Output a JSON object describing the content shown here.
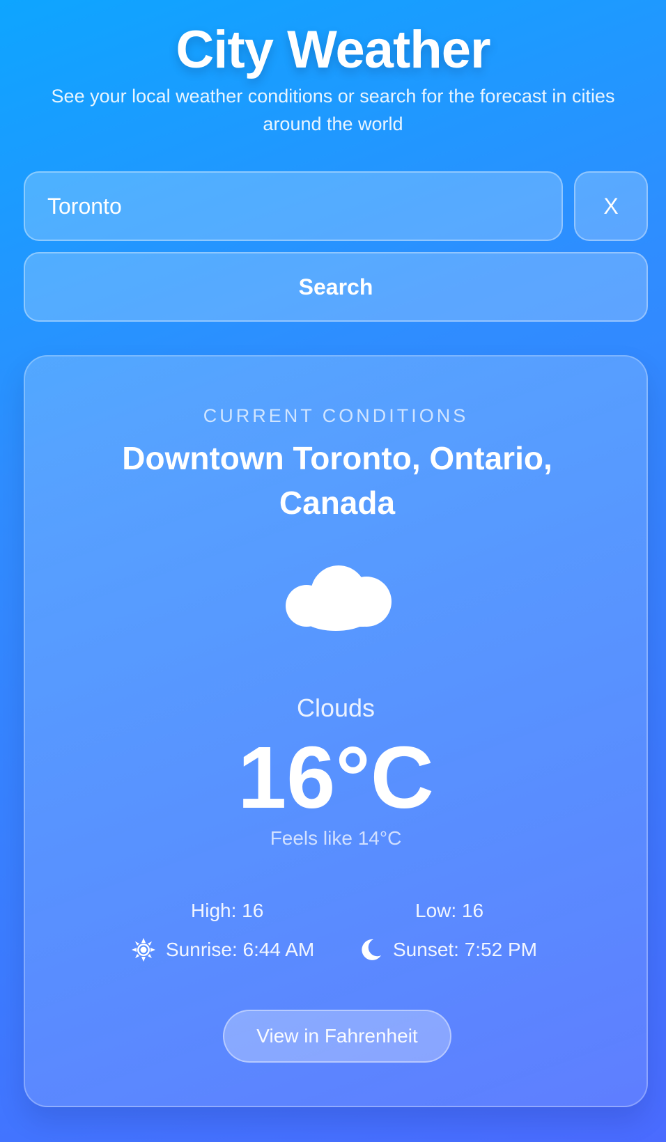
{
  "header": {
    "title": "City Weather",
    "subtitle": "See your local weather conditions or search for the forecast in cities around the world"
  },
  "search": {
    "value": "Toronto",
    "clear_label": "X",
    "search_label": "Search"
  },
  "card": {
    "label": "CURRENT CONDITIONS",
    "location": "Downtown Toronto, Ontario, Canada",
    "weather_icon": "cloud-icon",
    "condition": "Clouds",
    "temperature": "16°C",
    "feels_like": "Feels like 14°C",
    "high": "High: 16",
    "low": "Low: 16",
    "sunrise": "Sunrise: 6:44 AM",
    "sunrise_icon": "sun-icon",
    "sunset": "Sunset: 7:52 PM",
    "sunset_icon": "moon-icon",
    "unit_toggle_label": "View in Fahrenheit"
  },
  "colors": {
    "background_top": "#0ea5ff",
    "background_bottom": "#4a6bff",
    "text": "#ffffff"
  }
}
